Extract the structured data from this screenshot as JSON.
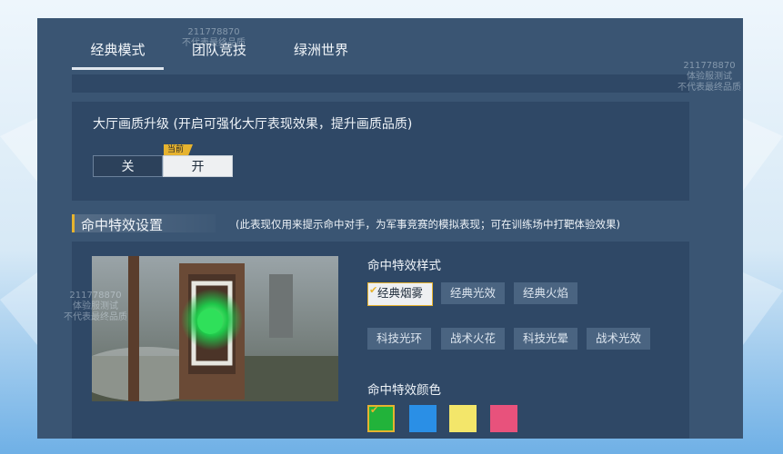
{
  "tabs": [
    {
      "label": "经典模式",
      "active": true
    },
    {
      "label": "团队竞技",
      "active": false
    },
    {
      "label": "绿洲世界",
      "active": false
    }
  ],
  "graphics": {
    "title": "大厅画质升级 (开启可强化大厅表现效果，提升画质品质)",
    "off_label": "关",
    "on_label": "开",
    "current_badge": "当前",
    "selected": "开"
  },
  "hit_effects": {
    "section_title": "命中特效设置",
    "section_note": "(此表现仅用来提示命中对手，为军事竞赛的模拟表现；可在训练场中打靶体验效果)",
    "style_label": "命中特效样式",
    "styles": [
      "经典烟雾",
      "经典光效",
      "经典火焰",
      "科技光环",
      "战术火花",
      "科技光晕",
      "战术光效"
    ],
    "selected_style": "经典烟雾",
    "color_label": "命中特效颜色",
    "colors": [
      "#22b33a",
      "#2a8fe6",
      "#f3e66a",
      "#e8527c"
    ],
    "selected_color": "#22b33a"
  },
  "watermark": {
    "id": "211778870",
    "line1": "体验服测试",
    "line2": "不代表最终品质"
  },
  "accent_color": "#e6b32f"
}
